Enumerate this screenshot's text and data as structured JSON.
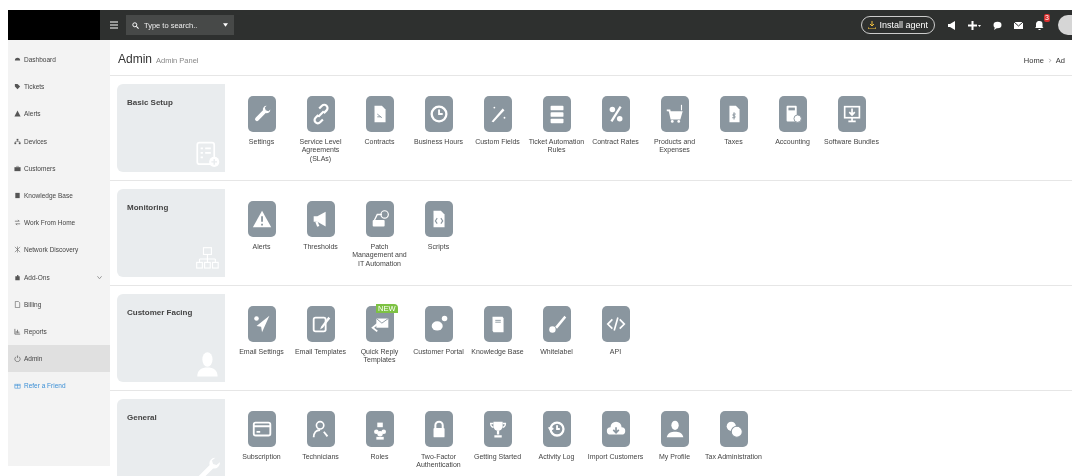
{
  "topbar": {
    "search": {
      "placeholder": "Type to search.."
    },
    "install_button": "Install agent",
    "notification_count": "3"
  },
  "sidebar": {
    "items": [
      {
        "label": "Dashboard",
        "kind": "item",
        "selected": false
      },
      {
        "label": "Tickets",
        "kind": "item",
        "selected": false
      },
      {
        "label": "Alerts",
        "kind": "item",
        "selected": false
      },
      {
        "label": "Devices",
        "kind": "item",
        "selected": false
      },
      {
        "label": "Customers",
        "kind": "item",
        "selected": false
      },
      {
        "label": "Knowledge Base",
        "kind": "item",
        "selected": false
      },
      {
        "label": "Work From Home",
        "kind": "item",
        "selected": false
      },
      {
        "label": "Network Discovery",
        "kind": "item",
        "selected": false
      },
      {
        "label": "Add-Ons",
        "kind": "submenu",
        "selected": false
      },
      {
        "label": "Billing",
        "kind": "item",
        "selected": false
      },
      {
        "label": "Reports",
        "kind": "item",
        "selected": false
      },
      {
        "label": "Admin",
        "kind": "item",
        "selected": true
      },
      {
        "label": "Refer a Friend",
        "kind": "link",
        "selected": false
      }
    ]
  },
  "header": {
    "title": "Admin",
    "subtitle": "Admin Panel",
    "breadcrumb": [
      "Home",
      "Ad"
    ]
  },
  "sections": [
    {
      "title": "Basic Setup",
      "items": [
        {
          "label": "Settings"
        },
        {
          "label": "Service Level Agreements (SLAs)"
        },
        {
          "label": "Contracts"
        },
        {
          "label": "Business Hours"
        },
        {
          "label": "Custom Fields"
        },
        {
          "label": "Ticket Automation Rules"
        },
        {
          "label": "Contract Rates"
        },
        {
          "label": "Products and Expenses"
        },
        {
          "label": "Taxes"
        },
        {
          "label": "Accounting"
        },
        {
          "label": "Software Bundles"
        }
      ]
    },
    {
      "title": "Monitoring",
      "items": [
        {
          "label": "Alerts"
        },
        {
          "label": "Thresholds"
        },
        {
          "label": "Patch Management and IT Automation"
        },
        {
          "label": "Scripts"
        }
      ]
    },
    {
      "title": "Customer Facing",
      "items": [
        {
          "label": "Email Settings"
        },
        {
          "label": "Email Templates"
        },
        {
          "label": "Quick Reply Templates",
          "badge": "NEW"
        },
        {
          "label": "Customer Portal"
        },
        {
          "label": "Knowledge Base"
        },
        {
          "label": "Whitelabel"
        },
        {
          "label": "API"
        }
      ]
    },
    {
      "title": "General",
      "items": [
        {
          "label": "Subscription"
        },
        {
          "label": "Technicians"
        },
        {
          "label": "Roles"
        },
        {
          "label": "Two-Factor Authentication"
        },
        {
          "label": "Getting Started"
        },
        {
          "label": "Activity Log"
        },
        {
          "label": "Import Customers"
        },
        {
          "label": "My Profile"
        },
        {
          "label": "Tax Administration"
        }
      ]
    }
  ]
}
